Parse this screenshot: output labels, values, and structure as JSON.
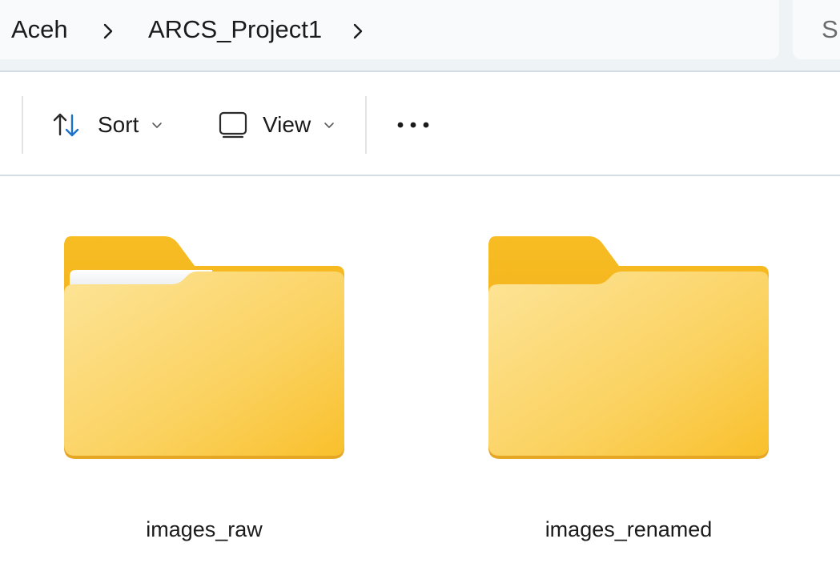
{
  "breadcrumb": {
    "items": [
      {
        "label": "Aceh"
      },
      {
        "label": "ARCS_Project1"
      }
    ]
  },
  "search": {
    "placeholder": "S"
  },
  "toolbar": {
    "sort_label": "Sort",
    "view_label": "View",
    "more_icon": "more-horizontal-icon",
    "sort_icon": "sort-arrows-icon",
    "view_icon": "view-monitor-icon"
  },
  "files": [
    {
      "name": "images_raw",
      "type": "folder",
      "has_contents": true
    },
    {
      "name": "images_renamed",
      "type": "folder",
      "has_contents": false
    }
  ],
  "colors": {
    "folder_back": "#f5b61c",
    "folder_front": "#fbd56b",
    "accent": "#1a73c9"
  }
}
